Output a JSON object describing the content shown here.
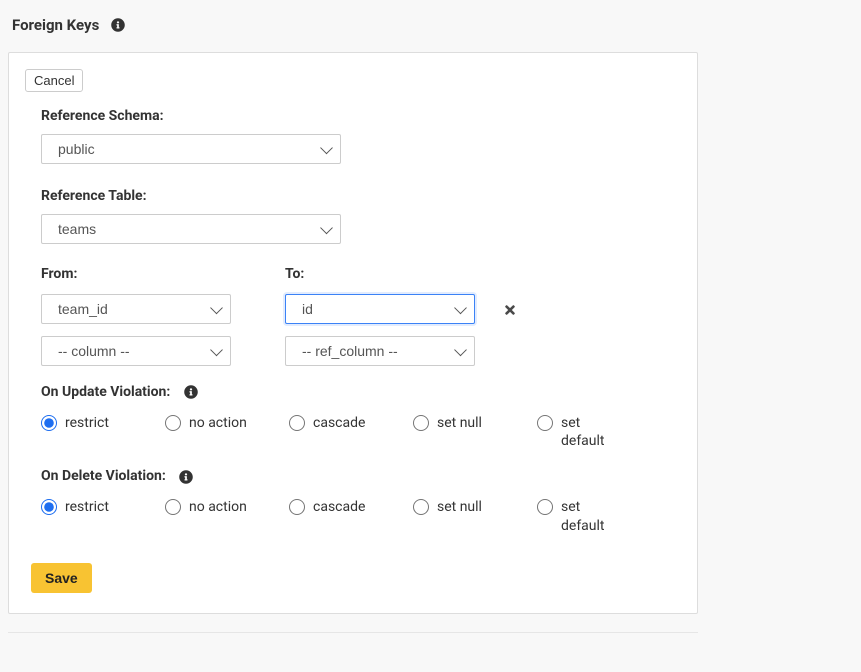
{
  "header": {
    "title": "Foreign Keys"
  },
  "buttons": {
    "cancel": "Cancel",
    "save": "Save"
  },
  "fields": {
    "reference_schema": {
      "label": "Reference Schema:",
      "value": "public"
    },
    "reference_table": {
      "label": "Reference Table:",
      "value": "teams"
    },
    "from": {
      "label": "From:",
      "selected": "team_id",
      "placeholder": "-- column --"
    },
    "to": {
      "label": "To:",
      "selected": "id",
      "placeholder": "-- ref_column --"
    }
  },
  "on_update": {
    "label": "On Update Violation:",
    "options": [
      "restrict",
      "no action",
      "cascade",
      "set null",
      "set default"
    ],
    "selected": "restrict"
  },
  "on_delete": {
    "label": "On Delete Violation:",
    "options": [
      "restrict",
      "no action",
      "cascade",
      "set null",
      "set default"
    ],
    "selected": "restrict"
  }
}
